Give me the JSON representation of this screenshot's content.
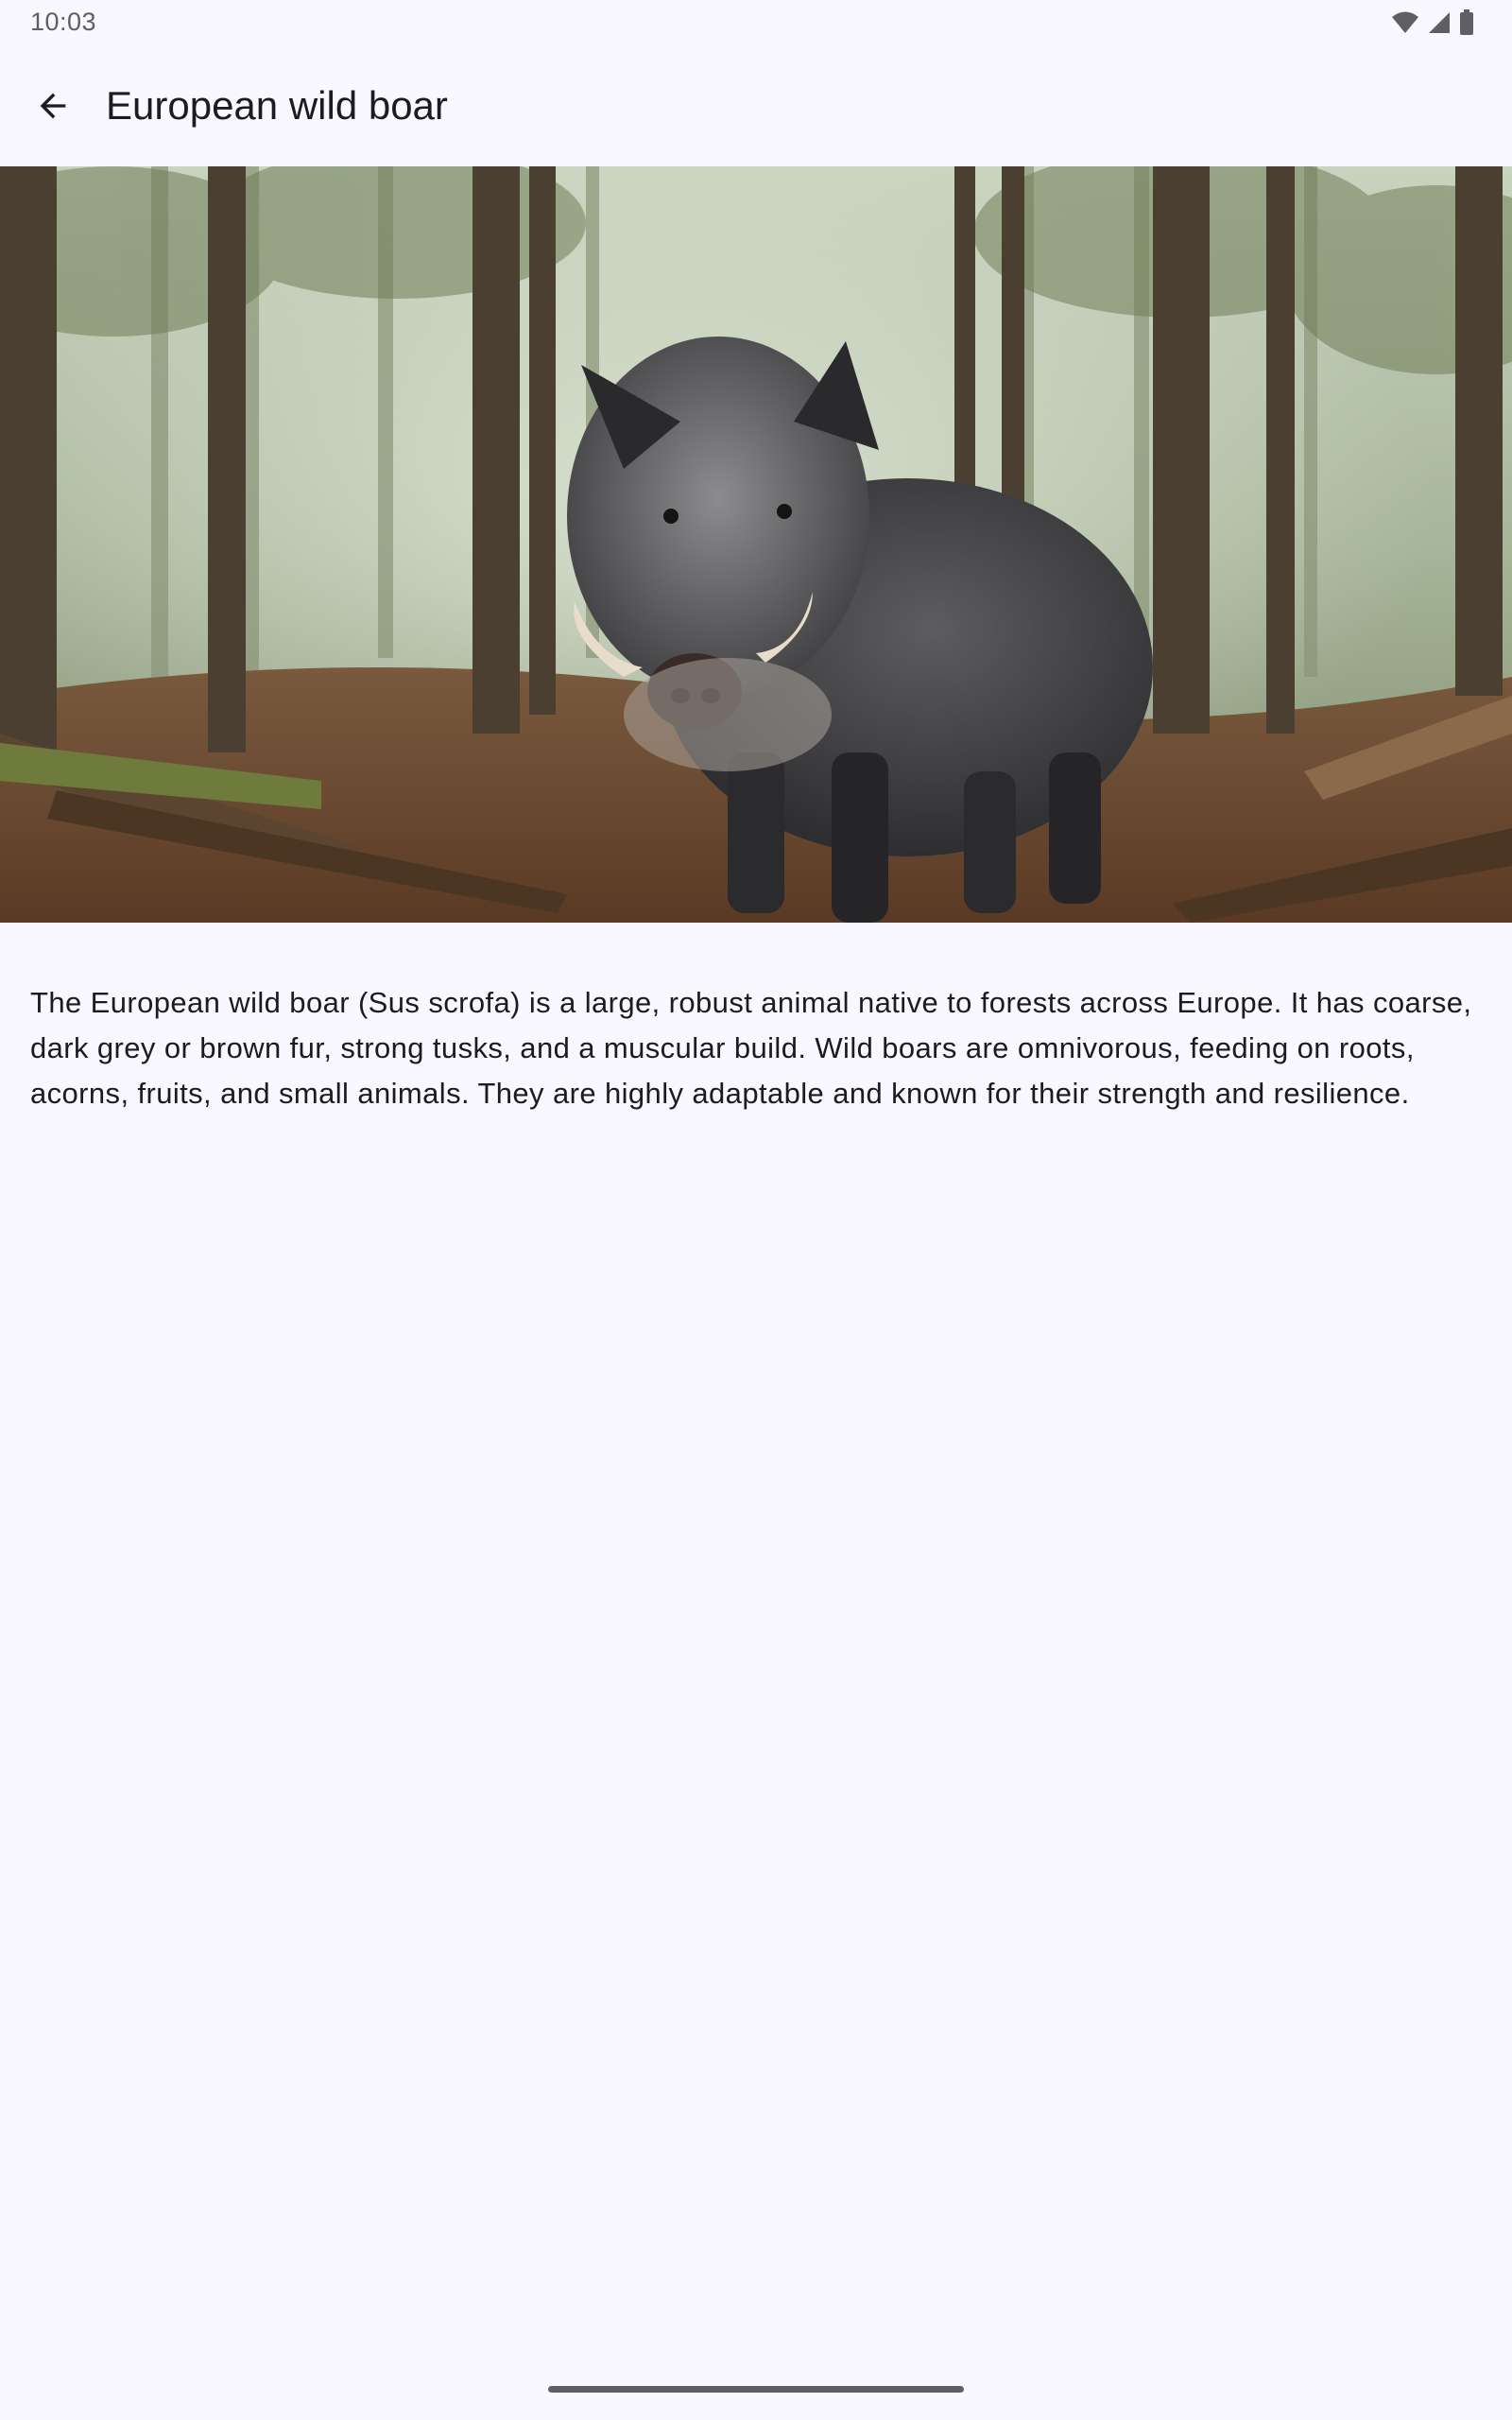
{
  "status_bar": {
    "time": "10:03",
    "icons": [
      "wifi-icon",
      "cellular-signal-icon",
      "battery-icon"
    ]
  },
  "app_bar": {
    "back_icon": "arrow-left-icon",
    "title": "European wild boar"
  },
  "hero_image": {
    "subject": "European wild boar standing in a forest"
  },
  "description": "The European wild boar (Sus scrofa) is a large, robust animal native to forests across Europe. It has coarse, dark grey or brown fur, strong tusks, and a muscular build. Wild boars are omnivorous, feeding on roots, acorns, fruits, and small animals. They are highly adaptable and known for their strength and resilience.",
  "colors": {
    "background": "#f9f8fe",
    "text": "#1c1b20",
    "secondary_text": "#5f5e63"
  }
}
